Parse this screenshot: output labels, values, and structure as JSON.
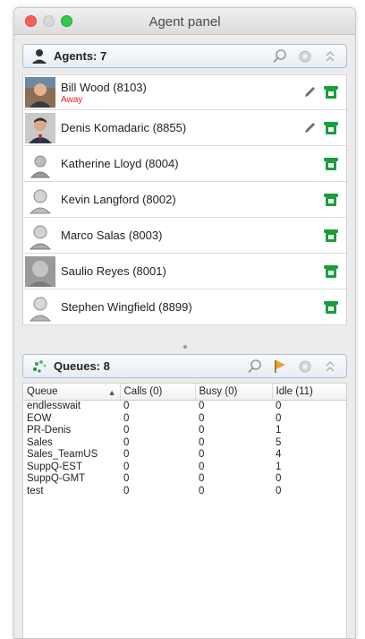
{
  "window": {
    "title": "Agent panel"
  },
  "agents_section": {
    "title": "Agents: 7",
    "tools": [
      "search-icon",
      "settings-icon",
      "collapse-icon"
    ]
  },
  "agents": [
    {
      "name": "Bill Wood (8103)",
      "status": "Away",
      "avatar": "photo-bill",
      "edit": true
    },
    {
      "name": "Denis Komadaric (8855)",
      "status": "",
      "avatar": "photo-denis",
      "edit": true
    },
    {
      "name": "Katherine Lloyd (8004)",
      "status": "",
      "avatar": "placeholder",
      "edit": false
    },
    {
      "name": "Kevin Langford (8002)",
      "status": "",
      "avatar": "placeholder",
      "edit": false
    },
    {
      "name": "Marco Salas (8003)",
      "status": "",
      "avatar": "placeholder",
      "edit": false
    },
    {
      "name": "Saulio Reyes (8001)",
      "status": "",
      "avatar": "photo-saulio",
      "edit": false
    },
    {
      "name": "Stephen Wingfield (8899)",
      "status": "",
      "avatar": "placeholder",
      "edit": false
    }
  ],
  "queues_section": {
    "title": "Queues: 8",
    "tools": [
      "search-icon",
      "flag-icon",
      "settings-icon",
      "collapse-icon"
    ]
  },
  "queue_table": {
    "columns": [
      "Queue",
      "Calls (0)",
      "Busy (0)",
      "Idle (11)"
    ],
    "rows": [
      [
        "endlesswait",
        "0",
        "0",
        "0"
      ],
      [
        "EOW",
        "0",
        "0",
        "0"
      ],
      [
        "PR-Denis",
        "0",
        "0",
        "1"
      ],
      [
        "Sales",
        "0",
        "0",
        "5"
      ],
      [
        "Sales_TeamUS",
        "0",
        "0",
        "4"
      ],
      [
        "SuppQ-EST",
        "0",
        "0",
        "1"
      ],
      [
        "SuppQ-GMT",
        "0",
        "0",
        "0"
      ],
      [
        "test",
        "0",
        "0",
        "0"
      ]
    ]
  },
  "colors": {
    "phone_green": "#1a9e3a",
    "away_red": "#e02020",
    "header_border": "#a9c0d6"
  }
}
